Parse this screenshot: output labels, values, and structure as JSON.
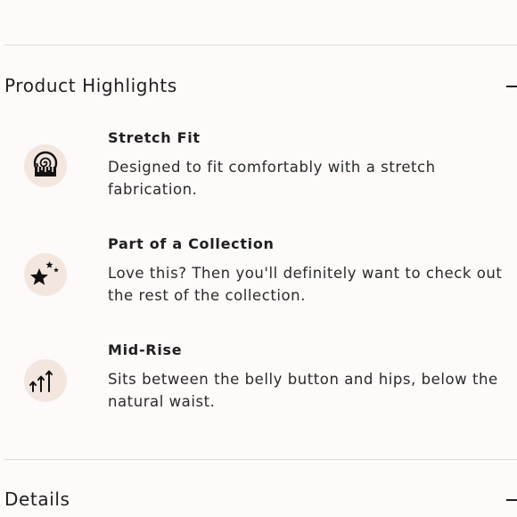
{
  "sections": {
    "highlights": {
      "title": "Product Highlights",
      "state": "expanded",
      "items": [
        {
          "icon": "measuring-tape-icon",
          "title": "Stretch Fit",
          "description": "Designed to fit comfortably with a stretch fabrication."
        },
        {
          "icon": "star-collection-icon",
          "title": "Part of a Collection",
          "description": "Love this? Then you'll definitely want to check out the rest of the collection."
        },
        {
          "icon": "up-arrows-icon",
          "title": "Mid-Rise",
          "description": "Sits between the belly button and hips, below the natural waist."
        }
      ]
    },
    "details": {
      "title": "Details",
      "state": "expanded"
    }
  },
  "colors": {
    "background": "#fdfaf9",
    "icon_circle": "#f3e6df",
    "text": "#1f1f1f",
    "divider": "#dedada"
  }
}
